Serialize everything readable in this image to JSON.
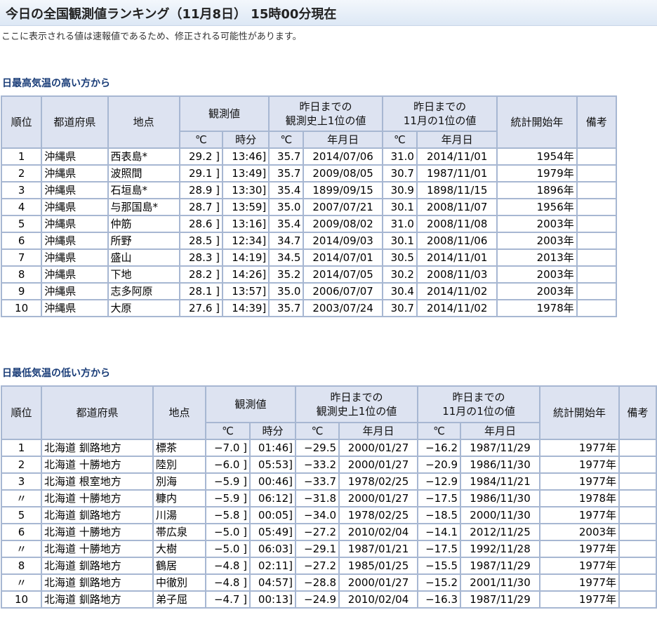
{
  "page_title": "今日の全国観測値ランキング（11月8日） 15時00分現在",
  "notice": "ここに表示される値は速報値であるため、修正される可能性があります。",
  "headers": {
    "rank": "順位",
    "prefecture": "都道府県",
    "point": "地点",
    "observed": "観測値",
    "celsius": "℃",
    "time": "時分",
    "record_history": "昨日までの\n観測史上1位の値",
    "record_month": "昨日までの\n11月の1位の値",
    "date": "年月日",
    "stats_start": "統計開始年",
    "remarks": "備考"
  },
  "tables": [
    {
      "title": "日最高気温の高い方から",
      "rows": [
        {
          "rank": "1",
          "pref": "沖縄県",
          "point": "西表島*",
          "value": "29.2 ]",
          "time": "13:46]",
          "hist_value": "35.7",
          "hist_date": "2014/07/06",
          "month_value": "31.0",
          "month_date": "2014/11/01",
          "start": "1954年",
          "note": ""
        },
        {
          "rank": "2",
          "pref": "沖縄県",
          "point": "波照間",
          "value": "29.1 ]",
          "time": "13:49]",
          "hist_value": "35.7",
          "hist_date": "2009/08/05",
          "month_value": "30.7",
          "month_date": "1987/11/01",
          "start": "1979年",
          "note": ""
        },
        {
          "rank": "3",
          "pref": "沖縄県",
          "point": "石垣島*",
          "value": "28.9 ]",
          "time": "13:30]",
          "hist_value": "35.4",
          "hist_date": "1899/09/15",
          "month_value": "30.9",
          "month_date": "1898/11/15",
          "start": "1896年",
          "note": ""
        },
        {
          "rank": "4",
          "pref": "沖縄県",
          "point": "与那国島*",
          "value": "28.7 ]",
          "time": "13:59]",
          "hist_value": "35.0",
          "hist_date": "2007/07/21",
          "month_value": "30.1",
          "month_date": "2008/11/07",
          "start": "1956年",
          "note": ""
        },
        {
          "rank": "5",
          "pref": "沖縄県",
          "point": "仲筋",
          "value": "28.6 ]",
          "time": "13:16]",
          "hist_value": "35.4",
          "hist_date": "2009/08/02",
          "month_value": "31.0",
          "month_date": "2008/11/08",
          "start": "2003年",
          "note": ""
        },
        {
          "rank": "6",
          "pref": "沖縄県",
          "point": "所野",
          "value": "28.5 ]",
          "time": "12:34]",
          "hist_value": "34.7",
          "hist_date": "2014/09/03",
          "month_value": "30.1",
          "month_date": "2008/11/06",
          "start": "2003年",
          "note": ""
        },
        {
          "rank": "7",
          "pref": "沖縄県",
          "point": "盛山",
          "value": "28.3 ]",
          "time": "14:19]",
          "hist_value": "34.5",
          "hist_date": "2014/07/01",
          "month_value": "30.5",
          "month_date": "2014/11/01",
          "start": "2013年",
          "note": ""
        },
        {
          "rank": "8",
          "pref": "沖縄県",
          "point": "下地",
          "value": "28.2 ]",
          "time": "14:26]",
          "hist_value": "35.2",
          "hist_date": "2014/07/05",
          "month_value": "30.2",
          "month_date": "2008/11/03",
          "start": "2003年",
          "note": ""
        },
        {
          "rank": "9",
          "pref": "沖縄県",
          "point": "志多阿原",
          "value": "28.1 ]",
          "time": "13:57]",
          "hist_value": "35.0",
          "hist_date": "2006/07/07",
          "month_value": "30.4",
          "month_date": "2014/11/02",
          "start": "2003年",
          "note": ""
        },
        {
          "rank": "10",
          "pref": "沖縄県",
          "point": "大原",
          "value": "27.6 ]",
          "time": "14:39]",
          "hist_value": "35.7",
          "hist_date": "2003/07/24",
          "month_value": "30.7",
          "month_date": "2014/11/02",
          "start": "1978年",
          "note": ""
        }
      ]
    },
    {
      "title": "日最低気温の低い方から",
      "rows": [
        {
          "rank": "1",
          "pref": "北海道 釧路地方",
          "point": "標茶",
          "value": "−7.0 ]",
          "time": "01:46]",
          "hist_value": "−29.5",
          "hist_date": "2000/01/27",
          "month_value": "−16.2",
          "month_date": "1987/11/29",
          "start": "1977年",
          "note": ""
        },
        {
          "rank": "2",
          "pref": "北海道 十勝地方",
          "point": "陸別",
          "value": "−6.0 ]",
          "time": "05:53]",
          "hist_value": "−33.2",
          "hist_date": "2000/01/27",
          "month_value": "−20.9",
          "month_date": "1986/11/30",
          "start": "1977年",
          "note": ""
        },
        {
          "rank": "3",
          "pref": "北海道 根室地方",
          "point": "別海",
          "value": "−5.9 ]",
          "time": "00:46]",
          "hist_value": "−33.7",
          "hist_date": "1978/02/25",
          "month_value": "−12.9",
          "month_date": "1984/11/21",
          "start": "1977年",
          "note": ""
        },
        {
          "rank": "〃",
          "pref": "北海道 十勝地方",
          "point": "糠内",
          "value": "−5.9 ]",
          "time": "06:12]",
          "hist_value": "−31.8",
          "hist_date": "2000/01/27",
          "month_value": "−17.5",
          "month_date": "1986/11/30",
          "start": "1978年",
          "note": ""
        },
        {
          "rank": "5",
          "pref": "北海道 釧路地方",
          "point": "川湯",
          "value": "−5.8 ]",
          "time": "00:05]",
          "hist_value": "−34.0",
          "hist_date": "1978/02/25",
          "month_value": "−18.5",
          "month_date": "2000/11/30",
          "start": "1977年",
          "note": ""
        },
        {
          "rank": "6",
          "pref": "北海道 十勝地方",
          "point": "帯広泉",
          "value": "−5.0 ]",
          "time": "05:49]",
          "hist_value": "−27.2",
          "hist_date": "2010/02/04",
          "month_value": "−14.1",
          "month_date": "2012/11/25",
          "start": "2003年",
          "note": ""
        },
        {
          "rank": "〃",
          "pref": "北海道 十勝地方",
          "point": "大樹",
          "value": "−5.0 ]",
          "time": "06:03]",
          "hist_value": "−29.1",
          "hist_date": "1987/01/21",
          "month_value": "−17.5",
          "month_date": "1992/11/28",
          "start": "1977年",
          "note": ""
        },
        {
          "rank": "8",
          "pref": "北海道 釧路地方",
          "point": "鶴居",
          "value": "−4.8 ]",
          "time": "02:11]",
          "hist_value": "−27.2",
          "hist_date": "1985/01/25",
          "month_value": "−15.5",
          "month_date": "1987/11/29",
          "start": "1977年",
          "note": ""
        },
        {
          "rank": "〃",
          "pref": "北海道 釧路地方",
          "point": "中徹別",
          "value": "−4.8 ]",
          "time": "04:57]",
          "hist_value": "−28.8",
          "hist_date": "2000/01/27",
          "month_value": "−15.2",
          "month_date": "2001/11/30",
          "start": "1977年",
          "note": ""
        },
        {
          "rank": "10",
          "pref": "北海道 釧路地方",
          "point": "弟子屈",
          "value": "−4.7 ]",
          "time": "00:13]",
          "hist_value": "−24.9",
          "hist_date": "2010/02/04",
          "month_value": "−16.3",
          "month_date": "1987/11/29",
          "start": "1977年",
          "note": ""
        }
      ]
    }
  ]
}
